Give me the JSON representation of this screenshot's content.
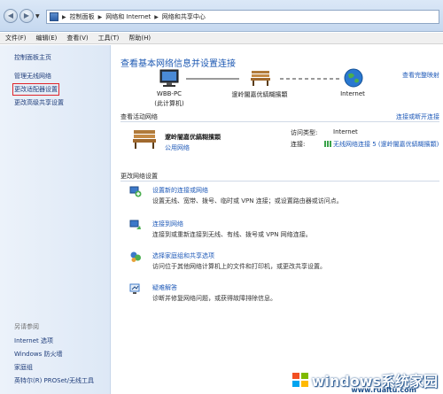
{
  "address": {
    "segments": [
      "控制面板",
      "网络和 Internet",
      "网络和共享中心"
    ]
  },
  "menu": [
    "文件(F)",
    "编辑(E)",
    "查看(V)",
    "工具(T)",
    "帮助(H)"
  ],
  "sidebar": {
    "home": "控制面板主页",
    "links": [
      "管理无线网络",
      "更改适配器设置",
      "更改高级共享设置"
    ],
    "see_also_heading": "另请参阅",
    "see_also": [
      "Internet 选项",
      "Windows 防火墙",
      "家庭组",
      "英特尔(R) PROSet/无线工具"
    ]
  },
  "main": {
    "title": "查看基本网络信息并设置连接",
    "full_map": "查看完整映射",
    "map": {
      "pc_name": "WBB-PC",
      "pc_sub": "(此计算机)",
      "network": "邃岭闇嘉优縞糊擯顆",
      "internet": "Internet"
    },
    "active_heading": "查看活动网络",
    "connect_or_disconnect": "连接或断开连接",
    "active": {
      "name": "邃岭闇嘉优縞糊擯顆",
      "type": "公用网络",
      "access_type_label": "访问类型:",
      "access_type_value": "Internet",
      "connections_label": "连接:",
      "connection_value": "无线网络连接 5 (邃岭闇嘉优縞糊擯顆)"
    },
    "change_heading": "更改网络设置",
    "tasks": [
      {
        "title": "设置新的连接或网络",
        "desc": "设置无线、宽带、拨号、临时或 VPN 连接；或设置路由器或访问点。"
      },
      {
        "title": "连接到网络",
        "desc": "连接到或重新连接到无线、有线、拨号或 VPN 网络连接。"
      },
      {
        "title": "选择家庭组和共享选项",
        "desc": "访问位于其他网络计算机上的文件和打印机，或更改共享设置。"
      },
      {
        "title": "疑难解答",
        "desc": "诊断并修复网络问题，或获得故障排除信息。"
      }
    ]
  },
  "watermark": {
    "text": "windows系统家园",
    "url": "www.ruaitu.com"
  }
}
